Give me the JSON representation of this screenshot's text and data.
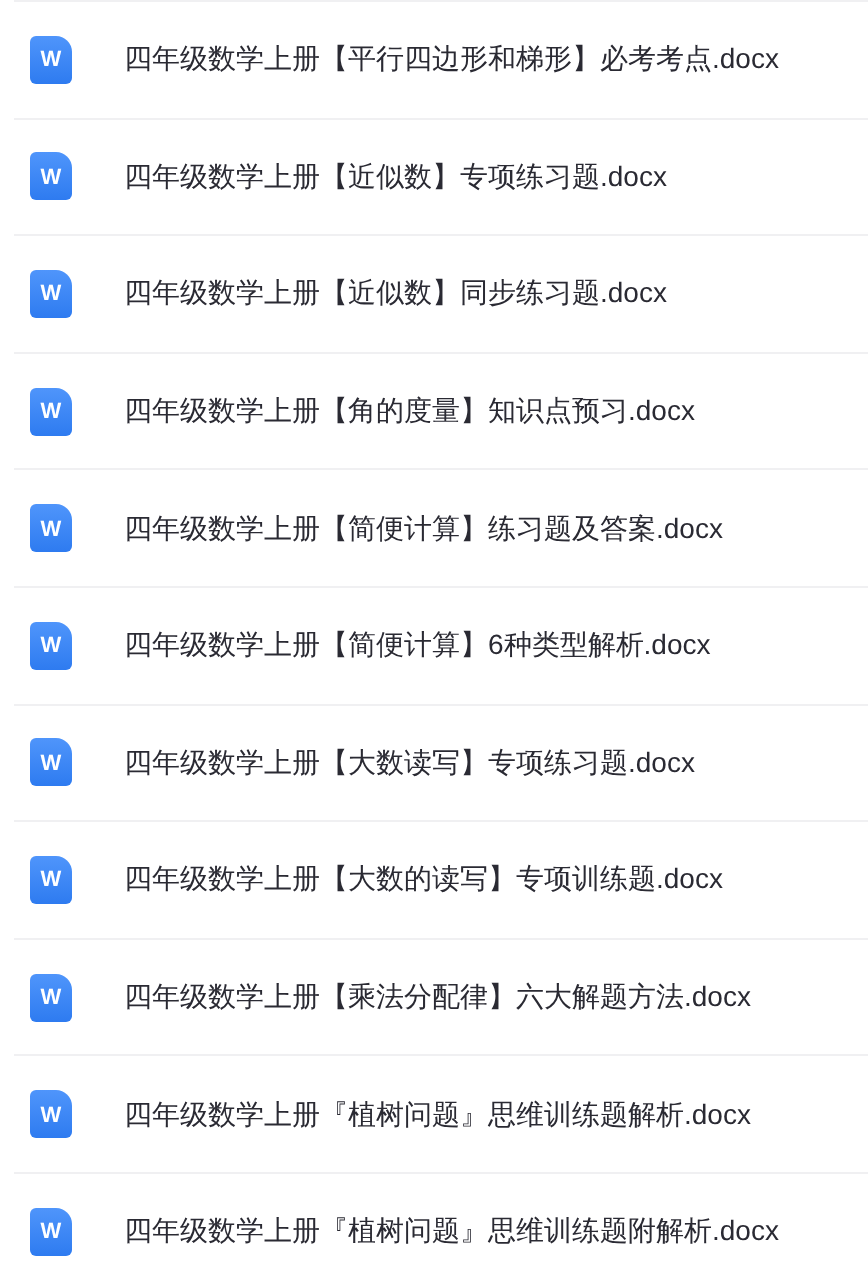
{
  "files": [
    {
      "icon_letter": "W",
      "name": "四年级数学上册【平行四边形和梯形】必考考点.docx"
    },
    {
      "icon_letter": "W",
      "name": "四年级数学上册【近似数】专项练习题.docx"
    },
    {
      "icon_letter": "W",
      "name": "四年级数学上册【近似数】同步练习题.docx"
    },
    {
      "icon_letter": "W",
      "name": "四年级数学上册【角的度量】知识点预习.docx"
    },
    {
      "icon_letter": "W",
      "name": "四年级数学上册【简便计算】练习题及答案.docx"
    },
    {
      "icon_letter": "W",
      "name": "四年级数学上册【简便计算】6种类型解析.docx"
    },
    {
      "icon_letter": "W",
      "name": "四年级数学上册【大数读写】专项练习题.docx"
    },
    {
      "icon_letter": "W",
      "name": "四年级数学上册【大数的读写】专项训练题.docx"
    },
    {
      "icon_letter": "W",
      "name": "四年级数学上册【乘法分配律】六大解题方法.docx"
    },
    {
      "icon_letter": "W",
      "name": "四年级数学上册『植树问题』思维训练题解析.docx"
    },
    {
      "icon_letter": "W",
      "name": "四年级数学上册『植树问题』思维训练题附解析.docx"
    }
  ]
}
